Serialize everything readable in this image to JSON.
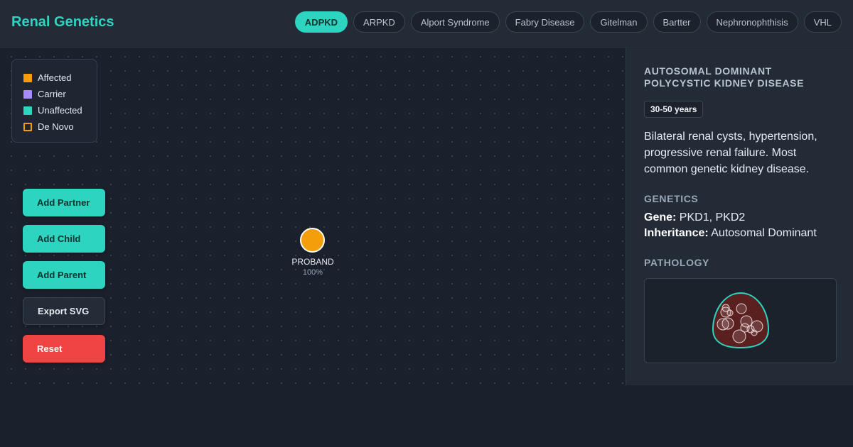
{
  "app": {
    "title": "Renal Genetics"
  },
  "tabs": [
    {
      "label": "ADPKD",
      "active": true
    },
    {
      "label": "ARPKD",
      "active": false
    },
    {
      "label": "Alport Syndrome",
      "active": false
    },
    {
      "label": "Fabry Disease",
      "active": false
    },
    {
      "label": "Gitelman",
      "active": false
    },
    {
      "label": "Bartter",
      "active": false
    },
    {
      "label": "Nephronophthisis",
      "active": false
    },
    {
      "label": "VHL",
      "active": false
    }
  ],
  "legend": {
    "items": [
      {
        "label": "Affected",
        "color": "#f59e0b",
        "style": "filled"
      },
      {
        "label": "Carrier",
        "color": "#a78bfa",
        "style": "filled"
      },
      {
        "label": "Unaffected",
        "color": "#2dd4bf",
        "style": "filled"
      },
      {
        "label": "De Novo",
        "color": "#f59e0b",
        "style": "outline"
      }
    ]
  },
  "actions": {
    "add_partner": "Add Partner",
    "add_child": "Add Child",
    "add_parent": "Add Parent",
    "export_svg": "Export SVG",
    "reset": "Reset"
  },
  "pedigree": {
    "proband": {
      "label": "PROBAND",
      "probability": "100%",
      "status": "affected"
    }
  },
  "disease": {
    "title": "Autosomal Dominant Polycystic Kidney Disease",
    "onset": "30-50 years",
    "description": "Bilateral renal cysts, hypertension, progressive renal failure. Most common genetic kidney disease.",
    "genetics_heading": "GENETICS",
    "gene_label": "Gene:",
    "gene_value": "PKD1, PKD2",
    "inheritance_label": "Inheritance:",
    "inheritance_value": "Autosomal Dominant",
    "pathology_heading": "PATHOLOGY"
  },
  "colors": {
    "accent": "#2dd4bf",
    "affected": "#f59e0b",
    "carrier": "#a78bfa",
    "danger": "#ef4444",
    "kidney_fill": "#5a1f1f"
  },
  "icons": {
    "pathology_image": "polycystic-kidney-illustration"
  }
}
